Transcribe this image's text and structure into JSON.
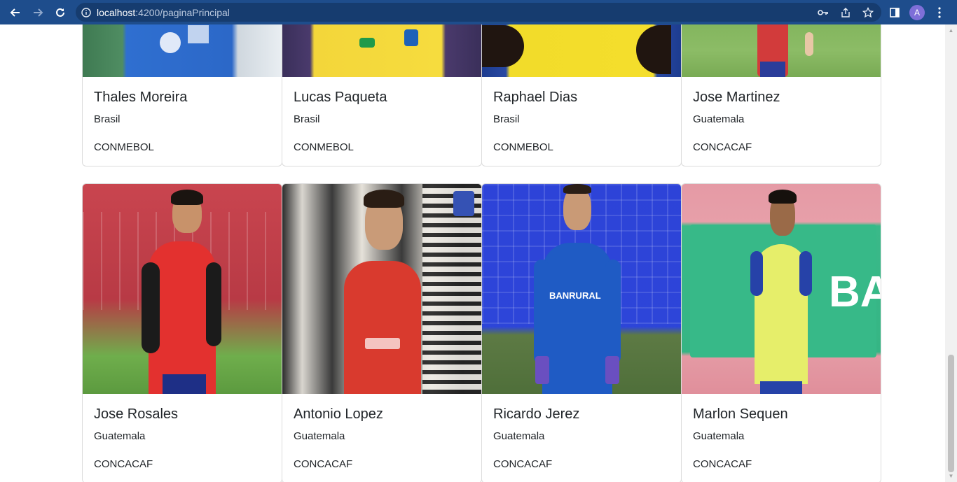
{
  "browser": {
    "url_host": "localhost",
    "url_rest": ":4200/paginaPrincipal",
    "profile_initial": "A"
  },
  "cards": [
    {
      "name": "Thales Moreira",
      "country": "Brasil",
      "confederation": "CONMEBOL"
    },
    {
      "name": "Lucas Paqueta",
      "country": "Brasil",
      "confederation": "CONMEBOL"
    },
    {
      "name": "Raphael Dias",
      "country": "Brasil",
      "confederation": "CONMEBOL"
    },
    {
      "name": "Jose Martinez",
      "country": "Guatemala",
      "confederation": "CONCACAF"
    },
    {
      "name": "Jose Rosales",
      "country": "Guatemala",
      "confederation": "CONCACAF"
    },
    {
      "name": "Antonio Lopez",
      "country": "Guatemala",
      "confederation": "CONCACAF"
    },
    {
      "name": "Ricardo Jerez",
      "country": "Guatemala",
      "confederation": "CONCACAF"
    },
    {
      "name": "Marlon Sequen",
      "country": "Guatemala",
      "confederation": "CONCACAF"
    }
  ],
  "photo_texts": {
    "jersey_brand_1": "BANRURAL",
    "board_text": "BA"
  }
}
